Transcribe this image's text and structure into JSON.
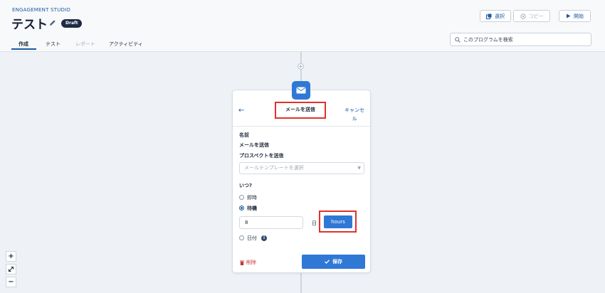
{
  "header": {
    "app_label": "ENGAGEMENT STUDIO",
    "title": "テスト",
    "badge": "Draft",
    "tabs": [
      {
        "label": "作成",
        "state": "active"
      },
      {
        "label": "テスト",
        "state": "normal"
      },
      {
        "label": "レポート",
        "state": "disabled"
      },
      {
        "label": "アクティビティ",
        "state": "normal"
      }
    ]
  },
  "toolbar": {
    "select_label": "選択",
    "copy_label": "コピー",
    "start_label": "開始",
    "search_placeholder": "このプログラムを検索"
  },
  "step_card": {
    "title": "メールを送信",
    "cancel_label": "キャンセル",
    "name_heading": "名前",
    "name_value": "メールを送信",
    "action_heading": "プロスペクトを送信",
    "template_placeholder": "メールテンプレートを選択",
    "when_heading": "いつ?",
    "options": {
      "immediate": "即時",
      "wait": "待機",
      "date": "日付"
    },
    "selected_option": "待機",
    "wait_value": "8",
    "unit_label": "日",
    "hours_label": "hours",
    "delete_label": "削除",
    "save_label": "保存"
  },
  "zoom_controls": {
    "zoom_in": "+",
    "zoom_out": "−"
  },
  "colors": {
    "accent": "#2f78d6",
    "link": "#1b5aa3",
    "highlight": "#e0322a",
    "delete": "#c23934",
    "canvas": "#eef1f6"
  }
}
